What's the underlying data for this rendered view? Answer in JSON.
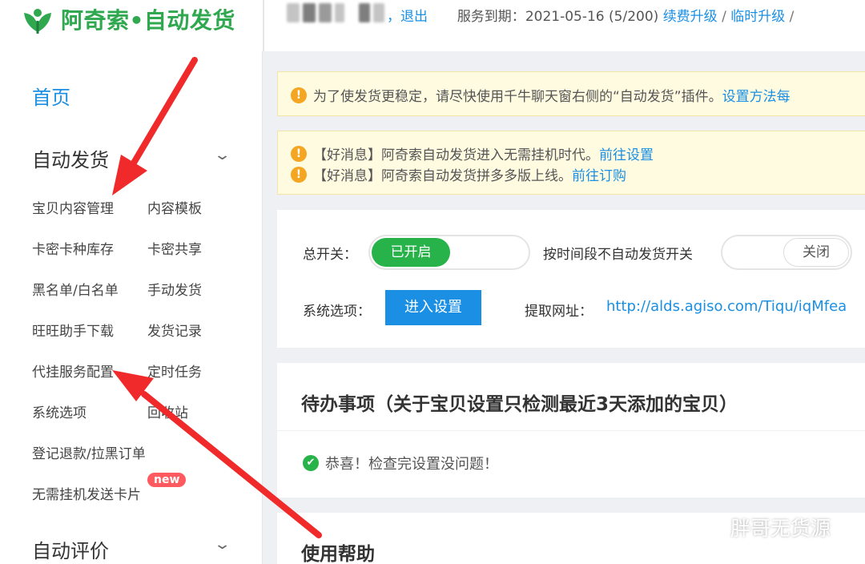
{
  "header": {
    "brand": "阿奇索•自动发货",
    "logout": "，退出",
    "service_label": "服务到期：",
    "service_date": "2021-05-16",
    "service_count": "(5/200)",
    "renew": "续费升级",
    "slash": "/",
    "temp_upgrade": "临时升级",
    "slash2": "/"
  },
  "sidebar": {
    "home": "首页",
    "auto_ship": "自动发货",
    "items": [
      "宝贝内容管理",
      "内容模板",
      "卡密卡种库存",
      "卡密共享",
      "黑名单/白名单",
      "手动发货",
      "旺旺助手下载",
      "发货记录",
      "代挂服务配置",
      "定时任务",
      "系统选项",
      "回收站",
      "登记退款/拉黑订单",
      "无需挂机发送卡片"
    ],
    "new_badge": "new",
    "auto_review": "自动评价"
  },
  "notices": {
    "n1_text": "为了使发货更稳定，请尽快使用千牛聊天窗右侧的“自动发货”插件。",
    "n1_link": "设置方法每",
    "n2_text": "【好消息】阿奇索自动发货进入无需挂机时代。",
    "n2_link": "前往设置",
    "n3_text": "【好消息】阿奇索自动发货拼多多版上线。",
    "n3_link": "前往订购"
  },
  "settings": {
    "master_label": "总开关：",
    "master_state": "已开启",
    "timed_label": "按时间段不自动发货开关",
    "timed_state": "关闭",
    "system_label": "系统选项：",
    "enter_button": "进入设置",
    "fetch_label": "提取网址：",
    "fetch_url": "http://alds.agiso.com/Tiqu/iqMfea"
  },
  "todo": {
    "title": "待办事项（关于宝贝设置只检测最近3天添加的宝贝）",
    "ok_text": "恭喜！检查完设置没问题！"
  },
  "help": {
    "title": "使用帮助"
  },
  "watermark": "胖哥无货源",
  "colors": {
    "brand_green": "#2fa84f",
    "link_blue": "#1a8fe3",
    "switch_green": "#27b24a",
    "arrow_red": "#f02a2a",
    "notice_bg": "#fffbe0"
  }
}
